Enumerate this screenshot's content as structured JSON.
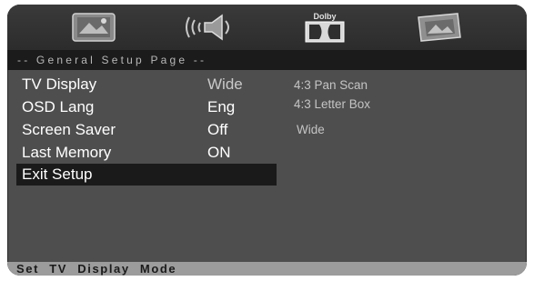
{
  "icons": {
    "tv": "tv-setup-icon",
    "audio": "speaker-audio-icon",
    "dolby": "dolby-icon",
    "video": "video-picture-icon",
    "dolby_label": "Dolby"
  },
  "page_bar": {
    "title": "-- General Setup Page --"
  },
  "menu": {
    "items": [
      {
        "label": "TV Display",
        "value": "Wide"
      },
      {
        "label": "OSD Lang",
        "value": "Eng"
      },
      {
        "label": "Screen Saver",
        "value": "Off"
      },
      {
        "label": "Last Memory",
        "value": "ON"
      },
      {
        "label": "Exit Setup",
        "value": ""
      }
    ],
    "options": [
      "4:3 Pan Scan",
      "4:3 Letter Box",
      "Wide"
    ]
  },
  "status": {
    "text": "Set TV Display Mode"
  },
  "colors": {
    "screen_bg": "#4e4e4e",
    "highlight_bg": "#1a1a1a",
    "status_bg": "#9c9c9c"
  }
}
